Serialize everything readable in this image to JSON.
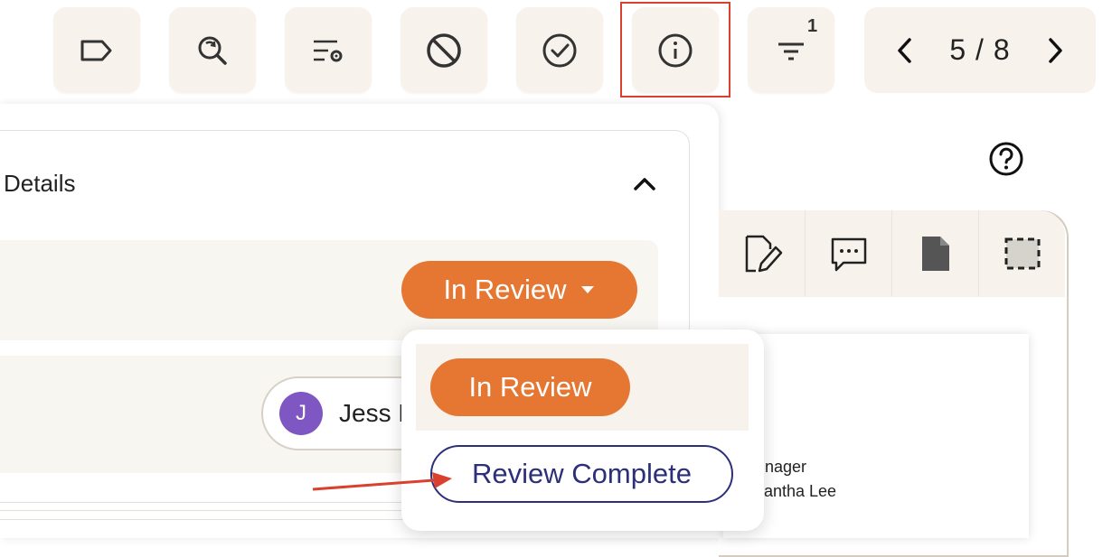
{
  "toolbar": {
    "buttons": [
      {
        "icon": "tag-icon"
      },
      {
        "icon": "search-refresh-icon"
      },
      {
        "icon": "list-settings-icon"
      },
      {
        "icon": "block-icon"
      },
      {
        "icon": "check-circle-icon"
      },
      {
        "icon": "info-icon",
        "highlighted": true
      },
      {
        "icon": "filter-icon",
        "badge": "1"
      }
    ],
    "filter_badge": "1",
    "pager": {
      "text": "5 / 8"
    }
  },
  "details": {
    "title": "Details",
    "status": {
      "current": "In Review"
    },
    "assignee": {
      "initial": "J",
      "name": "Jess L"
    }
  },
  "status_menu": {
    "options": [
      {
        "label": "In Review",
        "selected": true
      },
      {
        "label": "Review Complete",
        "selected": false
      }
    ]
  },
  "document": {
    "line1": "nager",
    "line2": "mantha Lee"
  },
  "colors": {
    "accent_orange": "#e57733",
    "navy": "#2c2f7a",
    "toolbar_bg": "#f7f3ec",
    "highlight_red": "#d9412e",
    "avatar_purple": "#7e57c2"
  }
}
